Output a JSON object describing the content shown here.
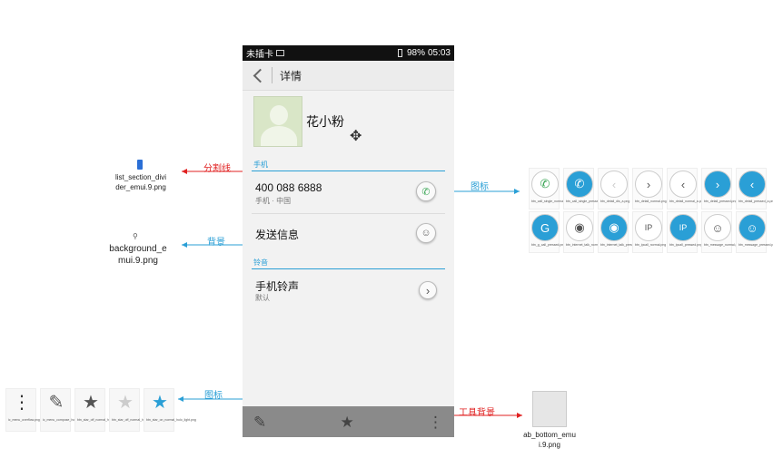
{
  "statusbar": {
    "carrier": "未插卡",
    "battery": "98%",
    "time": "05:03"
  },
  "actionbar": {
    "title": "详情"
  },
  "contact": {
    "name": "花小粉"
  },
  "sections": {
    "phone": "手机",
    "ringtone": "铃音"
  },
  "phone_item": {
    "number": "400 088 6888",
    "detail": "手机 · 中国"
  },
  "message_item": {
    "label": "发送信息"
  },
  "ringtone_item": {
    "label": "手机铃声",
    "value": "默认"
  },
  "annotations": {
    "divider": "分割线",
    "background": "背景",
    "icons_right": "图标",
    "icons_left": "图标",
    "toolbar_bg": "工具背景"
  },
  "assets": {
    "divider_file": "list_section_divi\nder_emui.9.png",
    "background_file": "background_e\nmui.9.png",
    "toolbar_file": "ab_bottom_emu\ni.9.png"
  },
  "icon_grid": [
    {
      "label": "btn_call_single_normal.png",
      "glyph": "✆",
      "bg": "#ffffff",
      "fg": "#3aa655"
    },
    {
      "label": "btn_call_single_pressed.png",
      "glyph": "✆",
      "bg": "#2a9fd6",
      "fg": "#ffffff"
    },
    {
      "label": "btn_detail_dis_a.png",
      "glyph": "‹",
      "bg": "#ffffff",
      "fg": "#cccccc"
    },
    {
      "label": "btn_detail_normal.png",
      "glyph": "›",
      "bg": "#ffffff",
      "fg": "#555555"
    },
    {
      "label": "btn_detail_normal_a.png",
      "glyph": "‹",
      "bg": "#ffffff",
      "fg": "#555555"
    },
    {
      "label": "btn_detail_pressed.png",
      "glyph": "›",
      "bg": "#2a9fd6",
      "fg": "#ffffff"
    },
    {
      "label": "btn_detail_pressed_a.png",
      "glyph": "‹",
      "bg": "#2a9fd6",
      "fg": "#ffffff"
    },
    {
      "label": "btn_g_call_pressed.png",
      "glyph": "G",
      "bg": "#2a9fd6",
      "fg": "#ffffff"
    },
    {
      "label": "btn_internet_talk_normal.png",
      "glyph": "◉",
      "bg": "#ffffff",
      "fg": "#555555"
    },
    {
      "label": "btn_internet_talk_pressed.png",
      "glyph": "◉",
      "bg": "#2a9fd6",
      "fg": "#ffffff"
    },
    {
      "label": "btn_ipcall_normal.png",
      "glyph": "IP",
      "bg": "#ffffff",
      "fg": "#555555"
    },
    {
      "label": "btn_ipcall_pressed.png",
      "glyph": "IP",
      "bg": "#2a9fd6",
      "fg": "#ffffff"
    },
    {
      "label": "btn_message_normal.png",
      "glyph": "☺",
      "bg": "#ffffff",
      "fg": "#555555"
    },
    {
      "label": "btn_message_pressed.png",
      "glyph": "☺",
      "bg": "#2a9fd6",
      "fg": "#ffffff"
    }
  ],
  "toolbar_icons": [
    {
      "label": "ic_menu_overflow.png",
      "glyph": "⋮",
      "fg": "#333333"
    },
    {
      "label": "ic_menu_compose_holo_dark.png",
      "glyph": "✎",
      "fg": "#555555"
    },
    {
      "label": "btn_star_off_normal_holo_dark.png",
      "glyph": "★",
      "fg": "#555555"
    },
    {
      "label": "btn_star_off_normal_holo_light.png",
      "glyph": "★",
      "fg": "#cccccc"
    },
    {
      "label": "btn_star_on_normal_holo_light.png",
      "glyph": "★",
      "fg": "#2a9fd6"
    }
  ],
  "colors": {
    "accent": "#2a9fd6",
    "arrow_red": "#e02020",
    "bottom_bar": "#8a8a8a"
  }
}
